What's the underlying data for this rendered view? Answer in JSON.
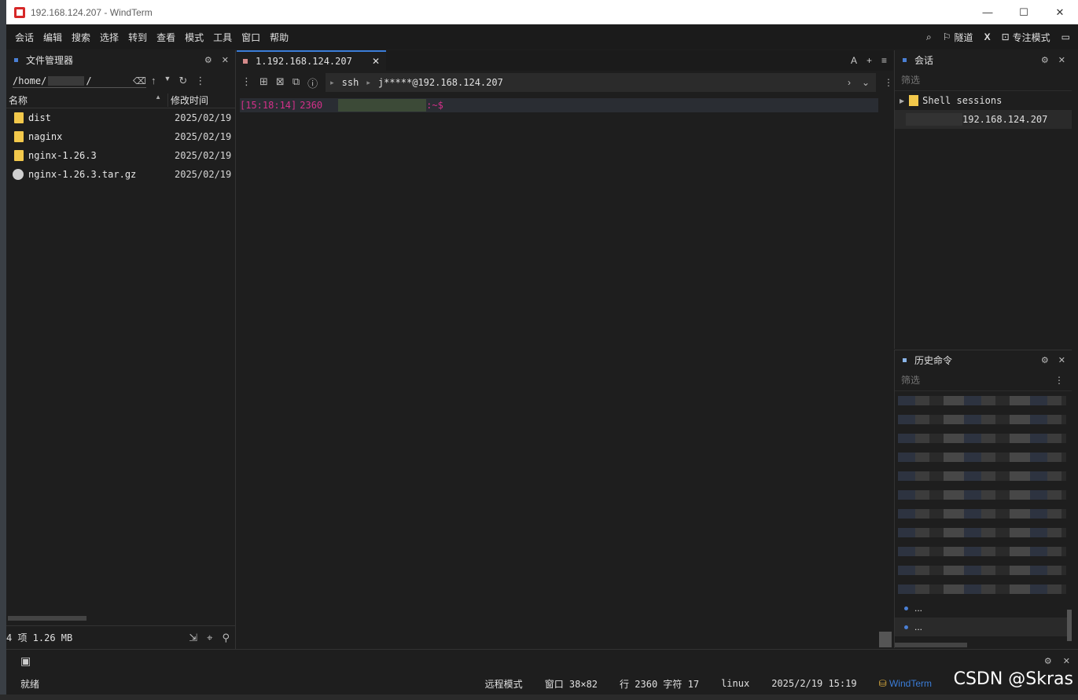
{
  "window": {
    "title": "192.168.124.207 - WindTerm",
    "minimize": "—",
    "maximize": "☐",
    "close": "✕"
  },
  "menu": [
    "会话",
    "编辑",
    "搜索",
    "选择",
    "转到",
    "查看",
    "模式",
    "工具",
    "窗口",
    "帮助"
  ],
  "menu_right": {
    "tunnel": "隧道",
    "x": "X",
    "focus": "专注模式"
  },
  "file_manager": {
    "title": "文件管理器",
    "path_prefix": "/home/",
    "path_suffix": "/",
    "col_name": "名称",
    "col_modified": "修改时间",
    "files": [
      {
        "name": "dist",
        "date": "2025/02/19",
        "type": "folder"
      },
      {
        "name": "naginx",
        "date": "2025/02/19",
        "type": "folder"
      },
      {
        "name": "nginx-1.26.3",
        "date": "2025/02/19",
        "type": "folder"
      },
      {
        "name": "nginx-1.26.3.tar.gz",
        "date": "2025/02/19",
        "type": "gz"
      }
    ],
    "footer": "4 项 1.26 MB"
  },
  "terminal": {
    "tab_label": "1.192.168.124.207",
    "tab_tools": {
      "font": "A",
      "add": "+",
      "menu": "≡"
    },
    "protocol": "ssh",
    "address": "j*****@192.168.124.207",
    "prompt_time": "[15:18:14]",
    "prompt_line": "2360",
    "prompt_tail": ":~$"
  },
  "sessions": {
    "title": "会话",
    "filter_placeholder": "筛选",
    "group": "Shell sessions",
    "item": "192.168.124.207"
  },
  "history": {
    "title": "历史命令",
    "filter_placeholder": "筛选",
    "more_1": "...",
    "more_2": "..."
  },
  "status": {
    "ready": "就绪",
    "mode": "远程模式",
    "window": "窗口 38×82",
    "cursor": "行 2360 字符 17",
    "os": "linux",
    "datetime": "2025/2/19 15:19",
    "app": "WindTerm"
  },
  "watermark": "CSDN @Skras"
}
